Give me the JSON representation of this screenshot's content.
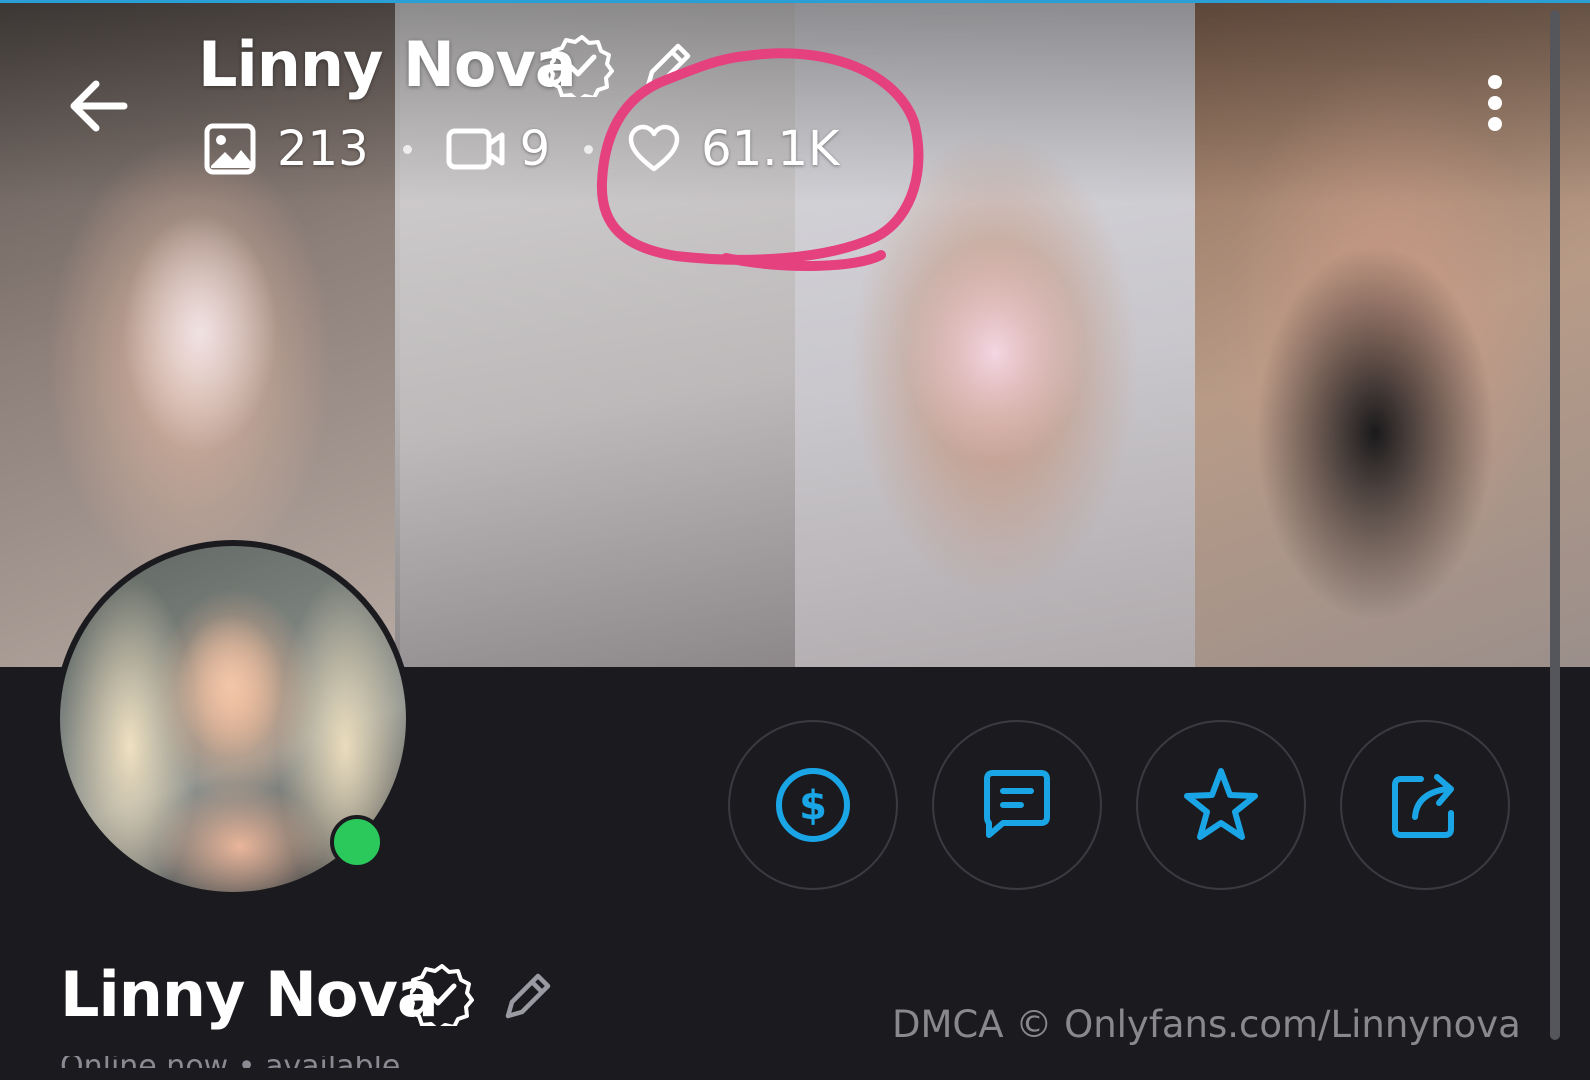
{
  "profile": {
    "name": "Linny Nova",
    "verified": true,
    "online": true,
    "bio_preview": "Online now • available"
  },
  "stats": {
    "photos": "213",
    "videos": "9",
    "likes": "61.1K"
  },
  "actions": [
    {
      "name": "tip-button",
      "icon": "dollar-circle-icon"
    },
    {
      "name": "message-button",
      "icon": "chat-icon"
    },
    {
      "name": "favorite-button",
      "icon": "star-icon"
    },
    {
      "name": "share-button",
      "icon": "share-icon"
    }
  ],
  "watermark": "DMCA © Onlyfans.com/Linnynova",
  "colors": {
    "background": "#1b1b1f",
    "accent": "#1aa6e6",
    "online": "#2bc85c",
    "highlight_circle": "#e5417f"
  }
}
